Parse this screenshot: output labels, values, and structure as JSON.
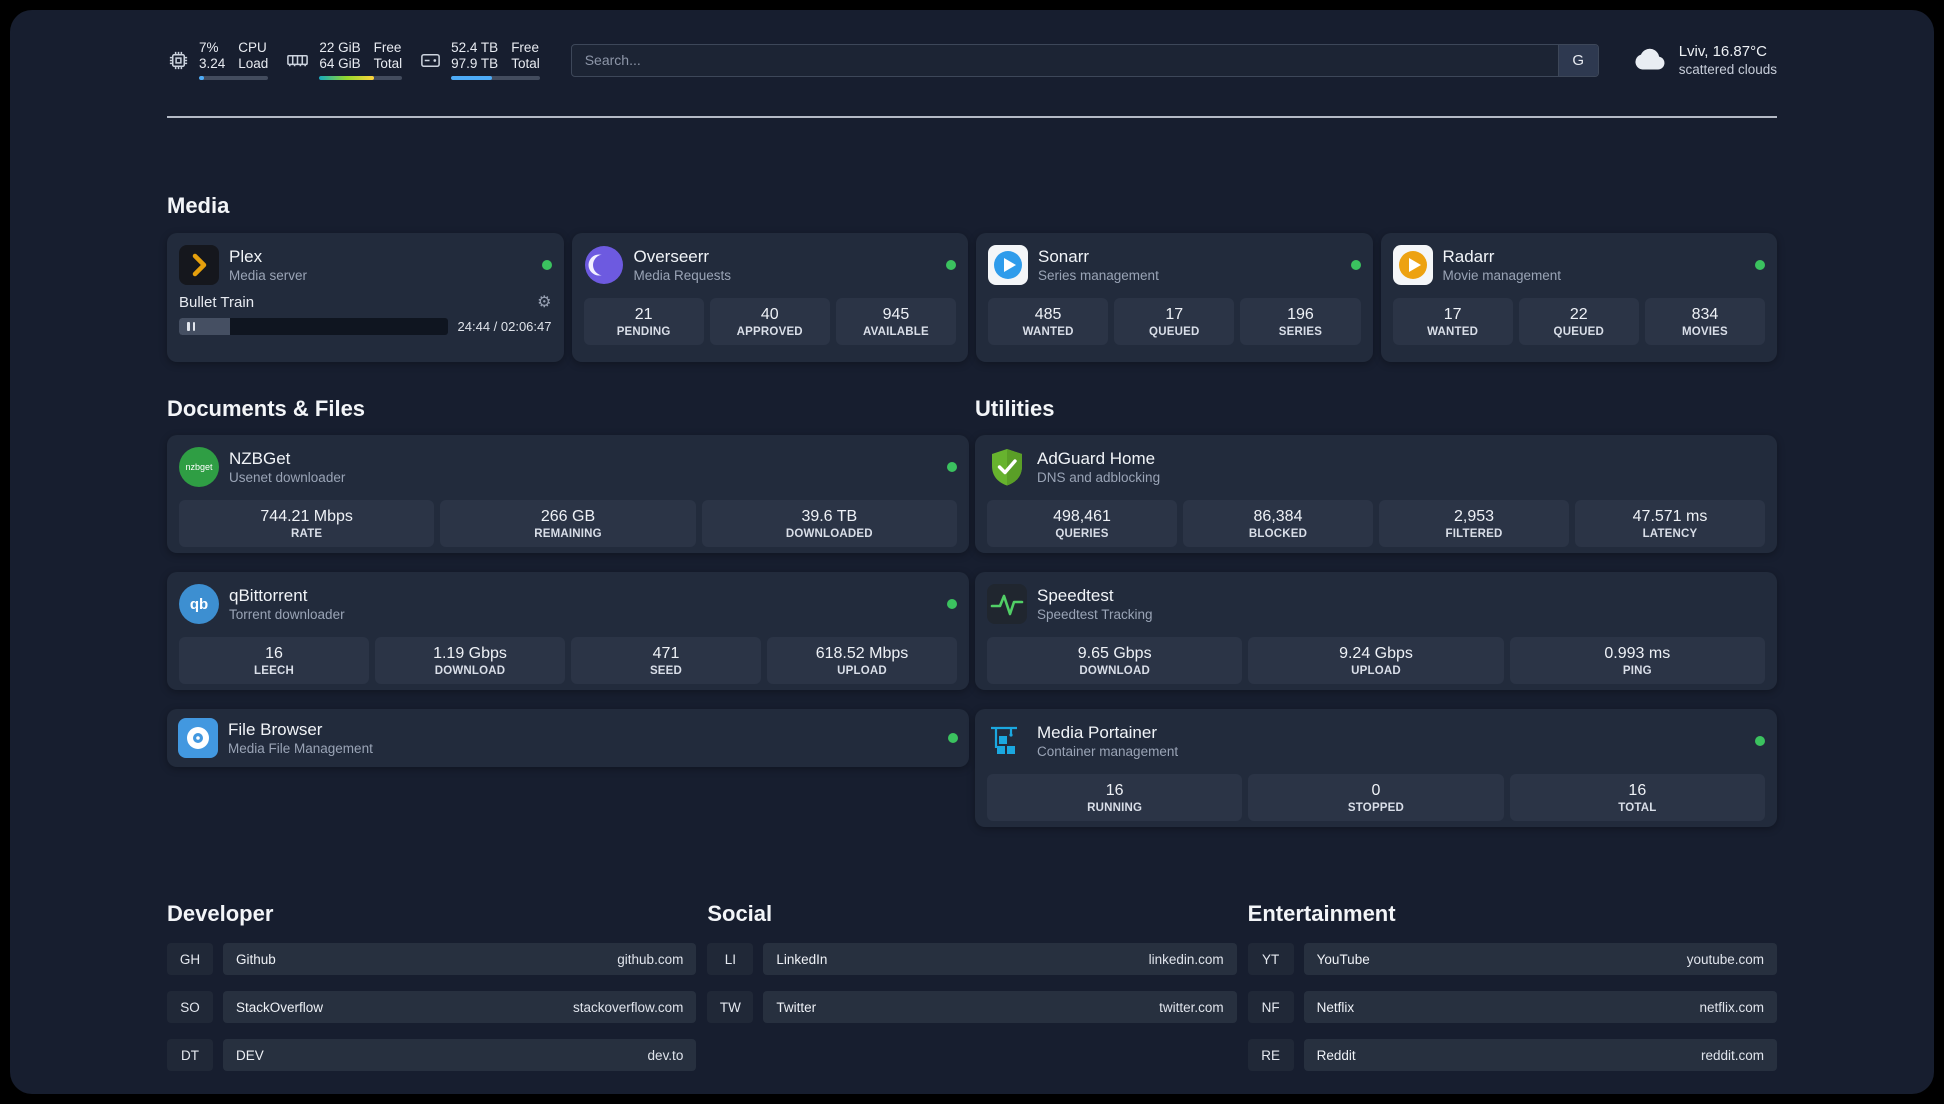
{
  "topbar": {
    "cpu": {
      "value1": "7%",
      "value2": "3.24",
      "label1": "CPU",
      "label2": "Load",
      "bar_percent": 7
    },
    "ram": {
      "value1": "22 GiB",
      "value2": "64 GiB",
      "label1": "Free",
      "label2": "Total",
      "bar_percent": 66
    },
    "disk": {
      "value1": "52.4 TB",
      "value2": "97.9 TB",
      "label1": "Free",
      "label2": "Total",
      "bar_percent": 46
    },
    "search": {
      "placeholder": "Search...",
      "engine_button": "G"
    },
    "weather": {
      "location": "Lviv, 16.87°C",
      "condition": "scattered clouds"
    }
  },
  "sections": {
    "media": {
      "title": "Media"
    },
    "documents": {
      "title": "Documents & Files"
    },
    "utilities": {
      "title": "Utilities"
    },
    "developer": {
      "title": "Developer"
    },
    "social": {
      "title": "Social"
    },
    "entertainment": {
      "title": "Entertainment"
    }
  },
  "apps": {
    "plex": {
      "name": "Plex",
      "subtitle": "Media server",
      "now_playing": "Bullet Train",
      "time": "24:44 / 02:06:47",
      "progress_percent": 19
    },
    "overseerr": {
      "name": "Overseerr",
      "subtitle": "Media Requests",
      "stats": [
        {
          "value": "21",
          "label": "PENDING"
        },
        {
          "value": "40",
          "label": "APPROVED"
        },
        {
          "value": "945",
          "label": "AVAILABLE"
        }
      ]
    },
    "sonarr": {
      "name": "Sonarr",
      "subtitle": "Series management",
      "stats": [
        {
          "value": "485",
          "label": "WANTED"
        },
        {
          "value": "17",
          "label": "QUEUED"
        },
        {
          "value": "196",
          "label": "SERIES"
        }
      ]
    },
    "radarr": {
      "name": "Radarr",
      "subtitle": "Movie management",
      "stats": [
        {
          "value": "17",
          "label": "WANTED"
        },
        {
          "value": "22",
          "label": "QUEUED"
        },
        {
          "value": "834",
          "label": "MOVIES"
        }
      ]
    },
    "nzbget": {
      "name": "NZBGet",
      "subtitle": "Usenet downloader",
      "icon_text": "nzbget",
      "stats": [
        {
          "value": "744.21 Mbps",
          "label": "RATE"
        },
        {
          "value": "266 GB",
          "label": "REMAINING"
        },
        {
          "value": "39.6 TB",
          "label": "DOWNLOADED"
        }
      ]
    },
    "qbittorrent": {
      "name": "qBittorrent",
      "subtitle": "Torrent downloader",
      "icon_text": "qb",
      "stats": [
        {
          "value": "16",
          "label": "LEECH"
        },
        {
          "value": "1.19 Gbps",
          "label": "DOWNLOAD"
        },
        {
          "value": "471",
          "label": "SEED"
        },
        {
          "value": "618.52 Mbps",
          "label": "UPLOAD"
        }
      ]
    },
    "filebrowser": {
      "name": "File Browser",
      "subtitle": "Media File Management"
    },
    "adguard": {
      "name": "AdGuard Home",
      "subtitle": "DNS and adblocking",
      "stats": [
        {
          "value": "498,461",
          "label": "QUERIES"
        },
        {
          "value": "86,384",
          "label": "BLOCKED"
        },
        {
          "value": "2,953",
          "label": "FILTERED"
        },
        {
          "value": "47.571 ms",
          "label": "LATENCY"
        }
      ]
    },
    "speedtest": {
      "name": "Speedtest",
      "subtitle": "Speedtest Tracking",
      "stats": [
        {
          "value": "9.65 Gbps",
          "label": "DOWNLOAD"
        },
        {
          "value": "9.24 Gbps",
          "label": "UPLOAD"
        },
        {
          "value": "0.993 ms",
          "label": "PING"
        }
      ]
    },
    "portainer": {
      "name": "Media Portainer",
      "subtitle": "Container management",
      "stats": [
        {
          "value": "16",
          "label": "RUNNING"
        },
        {
          "value": "0",
          "label": "STOPPED"
        },
        {
          "value": "16",
          "label": "TOTAL"
        }
      ]
    }
  },
  "bookmarks": {
    "developer": [
      {
        "abbr": "GH",
        "name": "Github",
        "url": "github.com"
      },
      {
        "abbr": "SO",
        "name": "StackOverflow",
        "url": "stackoverflow.com"
      },
      {
        "abbr": "DT",
        "name": "DEV",
        "url": "dev.to"
      }
    ],
    "social": [
      {
        "abbr": "LI",
        "name": "LinkedIn",
        "url": "linkedin.com"
      },
      {
        "abbr": "TW",
        "name": "Twitter",
        "url": "twitter.com"
      }
    ],
    "entertainment": [
      {
        "abbr": "YT",
        "name": "YouTube",
        "url": "youtube.com"
      },
      {
        "abbr": "NF",
        "name": "Netflix",
        "url": "netflix.com"
      },
      {
        "abbr": "RE",
        "name": "Reddit",
        "url": "reddit.com"
      }
    ]
  },
  "colors": {
    "accent_green": "#3bc25f",
    "bar_blue": "#4dabf7"
  }
}
